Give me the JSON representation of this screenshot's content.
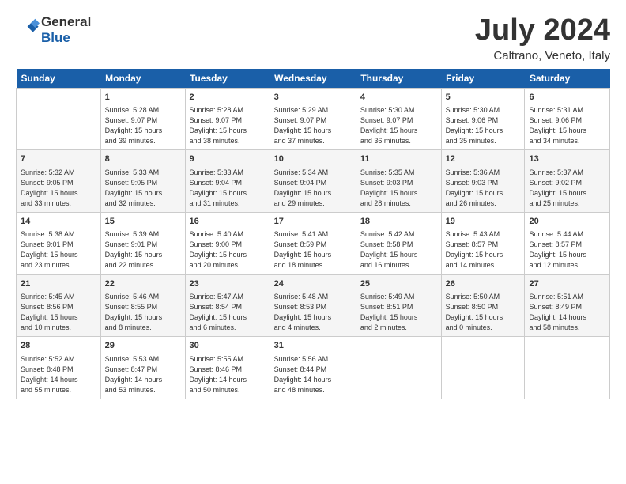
{
  "logo": {
    "line1": "General",
    "line2": "Blue"
  },
  "title": "July 2024",
  "subtitle": "Caltrano, Veneto, Italy",
  "days": [
    "Sunday",
    "Monday",
    "Tuesday",
    "Wednesday",
    "Thursday",
    "Friday",
    "Saturday"
  ],
  "weeks": [
    [
      {
        "num": "",
        "lines": []
      },
      {
        "num": "1",
        "lines": [
          "Sunrise: 5:28 AM",
          "Sunset: 9:07 PM",
          "Daylight: 15 hours",
          "and 39 minutes."
        ]
      },
      {
        "num": "2",
        "lines": [
          "Sunrise: 5:28 AM",
          "Sunset: 9:07 PM",
          "Daylight: 15 hours",
          "and 38 minutes."
        ]
      },
      {
        "num": "3",
        "lines": [
          "Sunrise: 5:29 AM",
          "Sunset: 9:07 PM",
          "Daylight: 15 hours",
          "and 37 minutes."
        ]
      },
      {
        "num": "4",
        "lines": [
          "Sunrise: 5:30 AM",
          "Sunset: 9:07 PM",
          "Daylight: 15 hours",
          "and 36 minutes."
        ]
      },
      {
        "num": "5",
        "lines": [
          "Sunrise: 5:30 AM",
          "Sunset: 9:06 PM",
          "Daylight: 15 hours",
          "and 35 minutes."
        ]
      },
      {
        "num": "6",
        "lines": [
          "Sunrise: 5:31 AM",
          "Sunset: 9:06 PM",
          "Daylight: 15 hours",
          "and 34 minutes."
        ]
      }
    ],
    [
      {
        "num": "7",
        "lines": [
          "Sunrise: 5:32 AM",
          "Sunset: 9:05 PM",
          "Daylight: 15 hours",
          "and 33 minutes."
        ]
      },
      {
        "num": "8",
        "lines": [
          "Sunrise: 5:33 AM",
          "Sunset: 9:05 PM",
          "Daylight: 15 hours",
          "and 32 minutes."
        ]
      },
      {
        "num": "9",
        "lines": [
          "Sunrise: 5:33 AM",
          "Sunset: 9:04 PM",
          "Daylight: 15 hours",
          "and 31 minutes."
        ]
      },
      {
        "num": "10",
        "lines": [
          "Sunrise: 5:34 AM",
          "Sunset: 9:04 PM",
          "Daylight: 15 hours",
          "and 29 minutes."
        ]
      },
      {
        "num": "11",
        "lines": [
          "Sunrise: 5:35 AM",
          "Sunset: 9:03 PM",
          "Daylight: 15 hours",
          "and 28 minutes."
        ]
      },
      {
        "num": "12",
        "lines": [
          "Sunrise: 5:36 AM",
          "Sunset: 9:03 PM",
          "Daylight: 15 hours",
          "and 26 minutes."
        ]
      },
      {
        "num": "13",
        "lines": [
          "Sunrise: 5:37 AM",
          "Sunset: 9:02 PM",
          "Daylight: 15 hours",
          "and 25 minutes."
        ]
      }
    ],
    [
      {
        "num": "14",
        "lines": [
          "Sunrise: 5:38 AM",
          "Sunset: 9:01 PM",
          "Daylight: 15 hours",
          "and 23 minutes."
        ]
      },
      {
        "num": "15",
        "lines": [
          "Sunrise: 5:39 AM",
          "Sunset: 9:01 PM",
          "Daylight: 15 hours",
          "and 22 minutes."
        ]
      },
      {
        "num": "16",
        "lines": [
          "Sunrise: 5:40 AM",
          "Sunset: 9:00 PM",
          "Daylight: 15 hours",
          "and 20 minutes."
        ]
      },
      {
        "num": "17",
        "lines": [
          "Sunrise: 5:41 AM",
          "Sunset: 8:59 PM",
          "Daylight: 15 hours",
          "and 18 minutes."
        ]
      },
      {
        "num": "18",
        "lines": [
          "Sunrise: 5:42 AM",
          "Sunset: 8:58 PM",
          "Daylight: 15 hours",
          "and 16 minutes."
        ]
      },
      {
        "num": "19",
        "lines": [
          "Sunrise: 5:43 AM",
          "Sunset: 8:57 PM",
          "Daylight: 15 hours",
          "and 14 minutes."
        ]
      },
      {
        "num": "20",
        "lines": [
          "Sunrise: 5:44 AM",
          "Sunset: 8:57 PM",
          "Daylight: 15 hours",
          "and 12 minutes."
        ]
      }
    ],
    [
      {
        "num": "21",
        "lines": [
          "Sunrise: 5:45 AM",
          "Sunset: 8:56 PM",
          "Daylight: 15 hours",
          "and 10 minutes."
        ]
      },
      {
        "num": "22",
        "lines": [
          "Sunrise: 5:46 AM",
          "Sunset: 8:55 PM",
          "Daylight: 15 hours",
          "and 8 minutes."
        ]
      },
      {
        "num": "23",
        "lines": [
          "Sunrise: 5:47 AM",
          "Sunset: 8:54 PM",
          "Daylight: 15 hours",
          "and 6 minutes."
        ]
      },
      {
        "num": "24",
        "lines": [
          "Sunrise: 5:48 AM",
          "Sunset: 8:53 PM",
          "Daylight: 15 hours",
          "and 4 minutes."
        ]
      },
      {
        "num": "25",
        "lines": [
          "Sunrise: 5:49 AM",
          "Sunset: 8:51 PM",
          "Daylight: 15 hours",
          "and 2 minutes."
        ]
      },
      {
        "num": "26",
        "lines": [
          "Sunrise: 5:50 AM",
          "Sunset: 8:50 PM",
          "Daylight: 15 hours",
          "and 0 minutes."
        ]
      },
      {
        "num": "27",
        "lines": [
          "Sunrise: 5:51 AM",
          "Sunset: 8:49 PM",
          "Daylight: 14 hours",
          "and 58 minutes."
        ]
      }
    ],
    [
      {
        "num": "28",
        "lines": [
          "Sunrise: 5:52 AM",
          "Sunset: 8:48 PM",
          "Daylight: 14 hours",
          "and 55 minutes."
        ]
      },
      {
        "num": "29",
        "lines": [
          "Sunrise: 5:53 AM",
          "Sunset: 8:47 PM",
          "Daylight: 14 hours",
          "and 53 minutes."
        ]
      },
      {
        "num": "30",
        "lines": [
          "Sunrise: 5:55 AM",
          "Sunset: 8:46 PM",
          "Daylight: 14 hours",
          "and 50 minutes."
        ]
      },
      {
        "num": "31",
        "lines": [
          "Sunrise: 5:56 AM",
          "Sunset: 8:44 PM",
          "Daylight: 14 hours",
          "and 48 minutes."
        ]
      },
      {
        "num": "",
        "lines": []
      },
      {
        "num": "",
        "lines": []
      },
      {
        "num": "",
        "lines": []
      }
    ]
  ]
}
